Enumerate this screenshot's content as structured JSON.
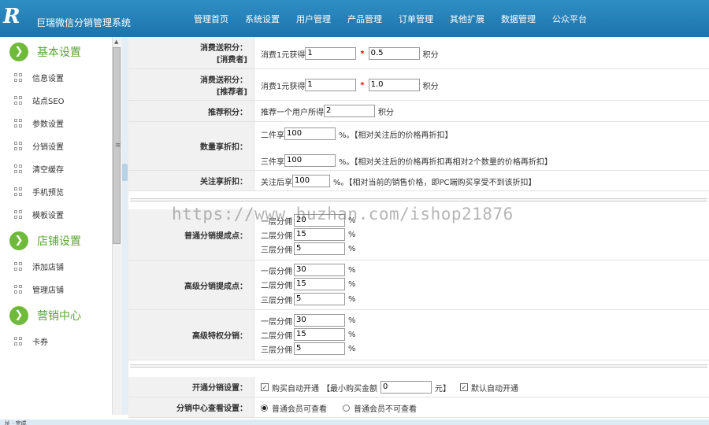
{
  "header": {
    "logo": "R",
    "system_name": "巨瑞微信分销管理系统",
    "nav": [
      "管理首页",
      "系统设置",
      "用户管理",
      "产品管理",
      "订单管理",
      "其他扩展",
      "数据管理",
      "公众平台"
    ]
  },
  "sidebar": {
    "groups": [
      {
        "title": "基本设置",
        "items": [
          "信息设置",
          "站点SEO",
          "参数设置",
          "分销设置",
          "清空缓存",
          "手机预览",
          "模板设置"
        ]
      },
      {
        "title": "店铺设置",
        "items": [
          "添加店铺",
          "管理店铺"
        ]
      },
      {
        "title": "营销中心",
        "items": [
          "卡券"
        ]
      }
    ]
  },
  "form": {
    "consume1": {
      "label1": "消费送积分：",
      "label2": "[消费者]",
      "prefix": "消费1元获得",
      "v1": "1",
      "mult": "*",
      "v2": "0.5",
      "unit": "积分"
    },
    "consume2": {
      "label1": "消费送积分：",
      "label2": "[推荐者]",
      "prefix": "消费1元获得",
      "v1": "1",
      "mult": "*",
      "v2": "1.0",
      "unit": "积分"
    },
    "recommend": {
      "label": "推荐积分：",
      "prefix": "推荐一个用户所得",
      "v": "2",
      "unit": "积分"
    },
    "qty": {
      "label": "数量享折扣：",
      "l1": "二件享",
      "v1": "100",
      "n1": "%。【相对关注后的价格再折扣】",
      "l2": "三件享",
      "v2": "100",
      "n2": "%。【相对关注后的价格再折扣再相对2个数量的价格再折扣】"
    },
    "follow": {
      "label": "关注享折扣：",
      "prefix": "关注后享",
      "v": "100",
      "note": "%。【相对当前的销售价格，即PC端购买享受不到该折扣】"
    },
    "normal": {
      "label": "普通分销提成点：",
      "rows": [
        {
          "l": "一层分佣",
          "v": "20",
          "u": "%"
        },
        {
          "l": "二层分佣",
          "v": "15",
          "u": "%"
        },
        {
          "l": "三层分佣",
          "v": "5",
          "u": "%"
        }
      ]
    },
    "advanced": {
      "label": "高级分销提成点：",
      "rows": [
        {
          "l": "一层分佣",
          "v": "30",
          "u": "%"
        },
        {
          "l": "二层分佣",
          "v": "15",
          "u": "%"
        },
        {
          "l": "三层分佣",
          "v": "5",
          "u": "%"
        }
      ]
    },
    "privilege": {
      "label": "高级特权分销：",
      "rows": [
        {
          "l": "一层分佣",
          "v": "30",
          "u": "%"
        },
        {
          "l": "二层分佣",
          "v": "15",
          "u": "%"
        },
        {
          "l": "三层分佣",
          "v": "5",
          "u": "%"
        }
      ]
    },
    "open": {
      "label": "开通分销设置：",
      "cb1": "购买自动开通",
      "min_label": "【最小购买金额",
      "min_v": "0",
      "min_unit": "元】",
      "cb2": "默认自动开通"
    },
    "center": {
      "label": "分销中心查看设置：",
      "r1": "普通会员可查看",
      "r2": "普通会员不可查看"
    }
  },
  "watermark": "https://www.huzhan.com/ishop21876",
  "status": "址 · 完成"
}
